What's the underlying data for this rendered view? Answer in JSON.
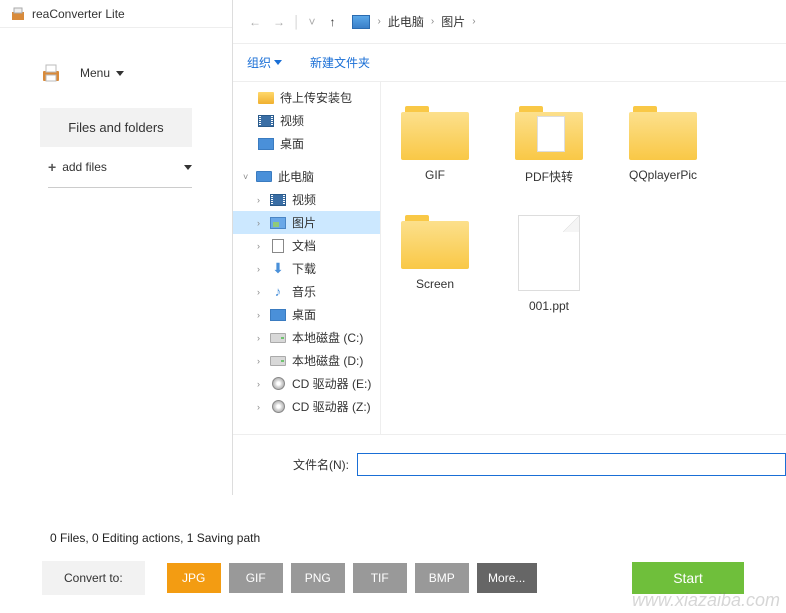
{
  "app": {
    "title": "reaConverter Lite"
  },
  "menu": {
    "label": "Menu"
  },
  "filesFolders": {
    "label": "Files and folders"
  },
  "addFiles": {
    "label": "add files"
  },
  "breadcrumb": {
    "root": "此电脑",
    "folder": "图片"
  },
  "toolbar": {
    "organize": "组织",
    "newFolder": "新建文件夹"
  },
  "tree": {
    "items": [
      {
        "label": "待上传安装包",
        "icon": "folder"
      },
      {
        "label": "视频",
        "icon": "video"
      },
      {
        "label": "桌面",
        "icon": "desktop"
      }
    ],
    "pc": "此电脑",
    "pcItems": [
      {
        "label": "视频",
        "icon": "video"
      },
      {
        "label": "图片",
        "icon": "pic",
        "selected": true
      },
      {
        "label": "文档",
        "icon": "doc"
      },
      {
        "label": "下载",
        "icon": "down"
      },
      {
        "label": "音乐",
        "icon": "music"
      },
      {
        "label": "桌面",
        "icon": "desktop"
      },
      {
        "label": "本地磁盘 (C:)",
        "icon": "drive"
      },
      {
        "label": "本地磁盘 (D:)",
        "icon": "drive"
      },
      {
        "label": "CD 驱动器 (E:)",
        "icon": "cd"
      },
      {
        "label": "CD 驱动器 (Z:)",
        "icon": "cd"
      }
    ]
  },
  "grid": {
    "folders": [
      {
        "label": "GIF"
      },
      {
        "label": "PDF快转"
      },
      {
        "label": "QQplayerPic"
      },
      {
        "label": "Screen"
      }
    ],
    "files": [
      {
        "label": "001.ppt"
      }
    ]
  },
  "filename": {
    "label": "文件名(N):",
    "value": ""
  },
  "status": {
    "text": "0 Files, 0 Editing actions, 1 Saving path"
  },
  "convert": {
    "label": "Convert to:",
    "formats": [
      "JPG",
      "GIF",
      "PNG",
      "TIF",
      "BMP"
    ],
    "more": "More...",
    "start": "Start"
  }
}
